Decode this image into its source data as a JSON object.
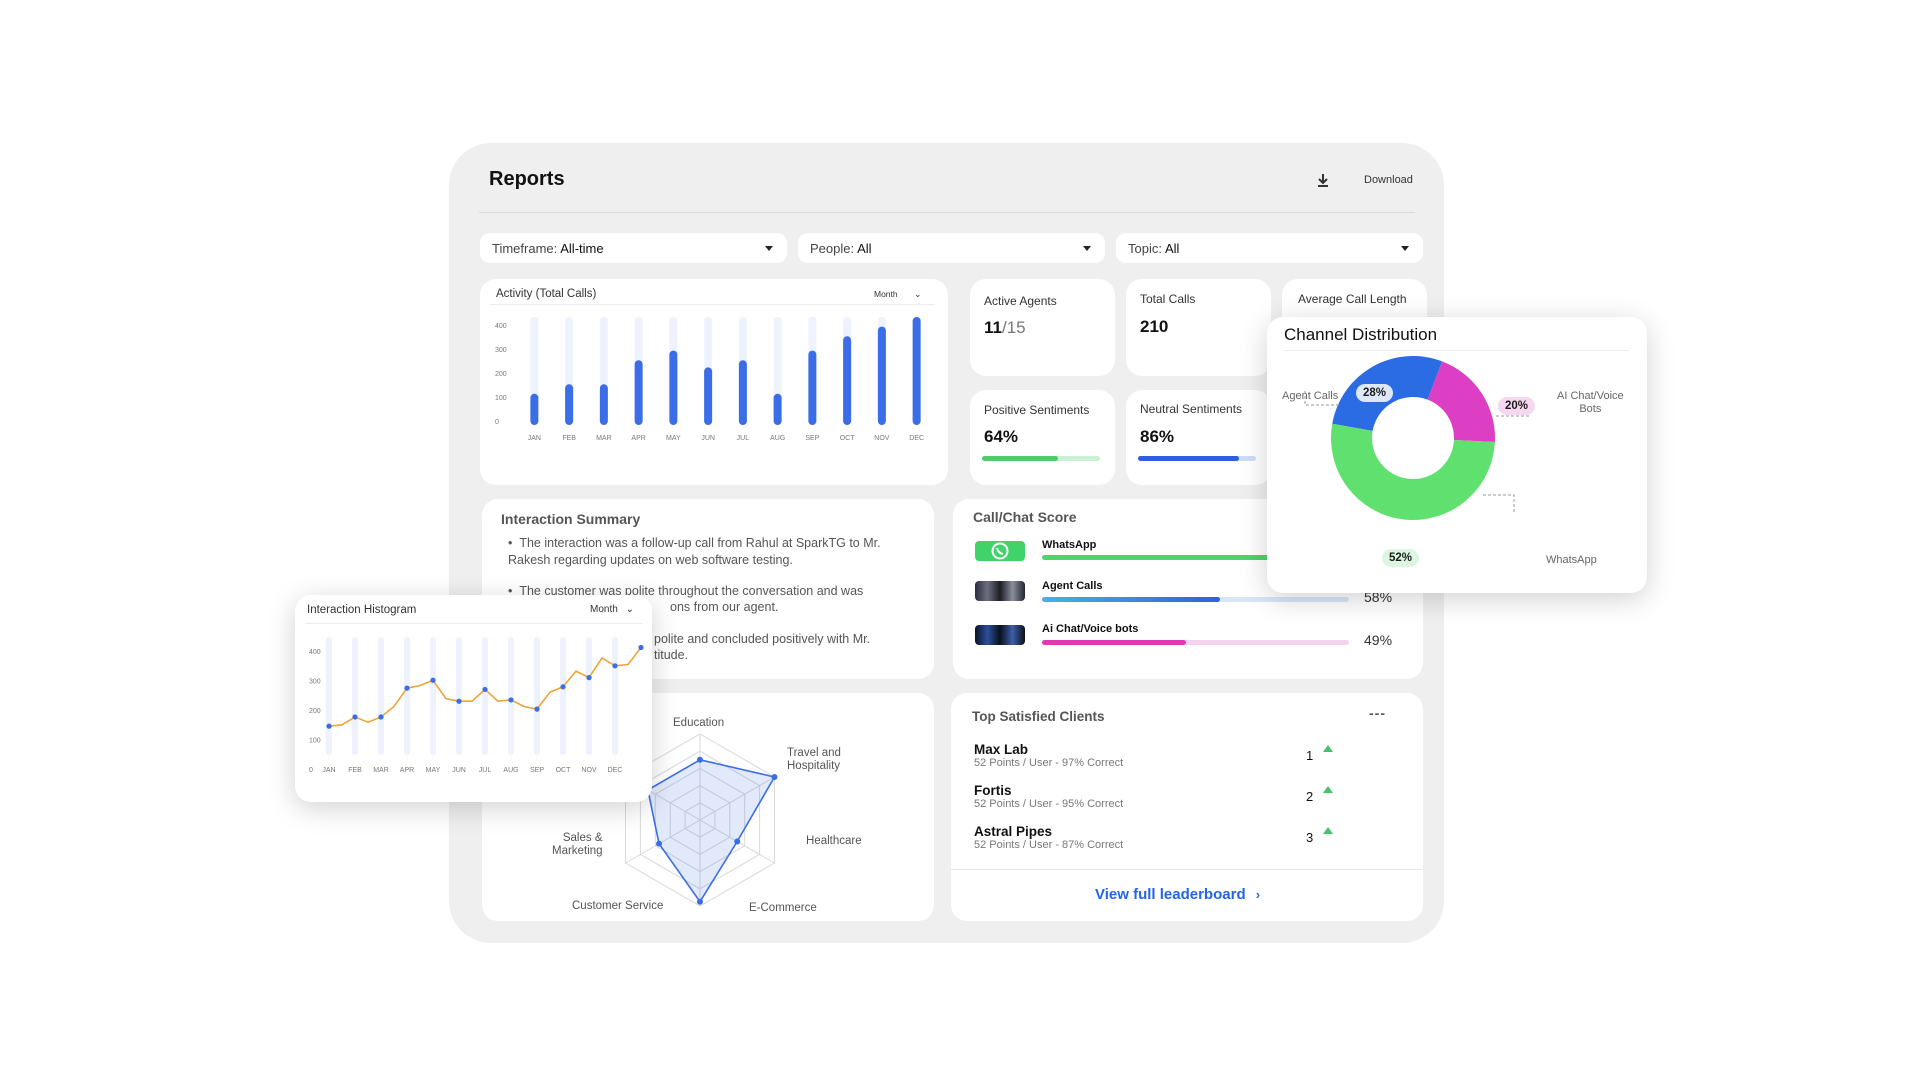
{
  "header": {
    "title": "Reports",
    "download_label": "Download"
  },
  "filters": [
    {
      "label": "Timeframe:",
      "value": "All-time"
    },
    {
      "label": "People:",
      "value": "All"
    },
    {
      "label": "Topic:",
      "value": "All"
    }
  ],
  "stats": {
    "active_agents": {
      "title": "Active Agents",
      "value": "11",
      "sub": "/15"
    },
    "total_calls": {
      "title": "Total Calls",
      "value": "210"
    },
    "avg_call_length": {
      "title": "Average Call Length"
    },
    "positive": {
      "title": "Positive Sentiments",
      "value": "64%",
      "fraction": 0.64,
      "color": "#4fcb6b"
    },
    "neutral": {
      "title": "Neutral Sentiments",
      "value": "86%",
      "fraction": 0.86,
      "color": "#2f5fe0"
    }
  },
  "activity": {
    "title": "Activity (Total Calls)",
    "period": "Month",
    "chart_data": {
      "type": "bar",
      "title": "Activity (Total Calls)",
      "categories": [
        "JAN",
        "FEB",
        "MAR",
        "APR",
        "MAY",
        "JUN",
        "JUL",
        "AUG",
        "SEP",
        "OCT",
        "NOV",
        "DEC"
      ],
      "values": [
        130,
        170,
        170,
        270,
        310,
        240,
        270,
        130,
        310,
        370,
        410,
        450
      ],
      "ylim": [
        0,
        450
      ],
      "yticks": [
        "400",
        "300",
        "200",
        "100",
        "0"
      ],
      "color": "#3b6de6"
    }
  },
  "summary": {
    "title": "Interaction Summary",
    "bullets": [
      "The interaction was a follow-up call from Rahul at SparkTG to Mr. Rakesh regarding updates on web software testing.",
      "The customer was polite throughout the conversation and was",
      "ons from our agent.",
      "polite and concluded positively with Mr.",
      "titude."
    ]
  },
  "score": {
    "title": "Call/Chat Score",
    "items": [
      {
        "label": "WhatsApp",
        "pct": "",
        "fraction": 0.78,
        "color": "#4fd36b",
        "track": "#d4f5dc"
      },
      {
        "label": "Agent Calls",
        "pct": "58%",
        "fraction": 0.58,
        "color": "#3b82e8",
        "track": "#d8e6fa"
      },
      {
        "label": "Ai Chat/Voice bots",
        "pct": "49%",
        "fraction": 0.47,
        "color": "#e03ab3",
        "track": "#f7d2ee"
      }
    ]
  },
  "channel": {
    "title": "Channel Distribution",
    "chart_data": {
      "type": "pie",
      "title": "Channel Distribution",
      "categories": [
        "Agent Calls",
        "AI Chat/Voice Bots",
        "WhatsApp"
      ],
      "values": [
        28,
        20,
        52
      ],
      "labels": [
        "28%",
        "20%",
        "52%"
      ],
      "colors": [
        "#2b6be4",
        "#dc3fc4",
        "#5fe06f"
      ]
    },
    "legend": {
      "agent": "Agent Calls",
      "ai_1": "AI Chat/Voice",
      "ai_2": "Bots",
      "whatsapp": "WhatsApp"
    }
  },
  "radar": {
    "chart_data": {
      "type": "radar",
      "categories": [
        "Education",
        "Travel and Hospitality",
        "Healthcare",
        "E-Commerce",
        "Customer Service",
        "Sales & Marketing"
      ],
      "values": [
        0.7,
        1.0,
        0.5,
        0.95,
        0.55,
        0.7
      ],
      "color": "#3b6de6"
    },
    "labels": {
      "education": "Education",
      "travel_1": "Travel and",
      "travel_2": "Hospitality",
      "healthcare": "Healthcare",
      "ecommerce": "E-Commerce",
      "customer": "Customer Service",
      "sales_1": "Sales &",
      "sales_2": "Marketing"
    }
  },
  "clients": {
    "title": "Top Satisfied Clients",
    "menu": "---",
    "items": [
      {
        "name": "Max Lab",
        "sub": "52 Points / User - 97% Correct",
        "rank": "1"
      },
      {
        "name": "Fortis",
        "sub": "52 Points / User - 95% Correct",
        "rank": "2"
      },
      {
        "name": "Astral Pipes",
        "sub": "52 Points / User -  87% Correct",
        "rank": "3"
      }
    ],
    "link": "View full leaderboard"
  },
  "histogram": {
    "title": "Interaction Histogram",
    "period": "Month",
    "chart_data": {
      "type": "line",
      "title": "Interaction Histogram",
      "categories": [
        "JAN",
        "FEB",
        "MAR",
        "APR",
        "MAY",
        "JUN",
        "JUL",
        "AUG",
        "SEP",
        "OCT",
        "NOV",
        "DEC"
      ],
      "x": [
        0,
        0.5,
        1,
        1.5,
        2,
        2.5,
        3,
        3.5,
        4,
        4.5,
        5,
        5.5,
        6,
        6.5,
        7,
        7.5,
        8,
        8.5,
        9,
        9.5,
        10,
        10.5,
        11,
        11.5,
        12
      ],
      "values": [
        110,
        115,
        145,
        125,
        145,
        185,
        255,
        265,
        285,
        215,
        205,
        205,
        250,
        205,
        210,
        185,
        175,
        240,
        260,
        320,
        295,
        370,
        340,
        345,
        410
      ],
      "ylim": [
        0,
        450
      ],
      "yticks": [
        "400",
        "300",
        "200",
        "100",
        "0"
      ],
      "line_color": "#f0a338",
      "point_color": "#3b6de6"
    }
  }
}
